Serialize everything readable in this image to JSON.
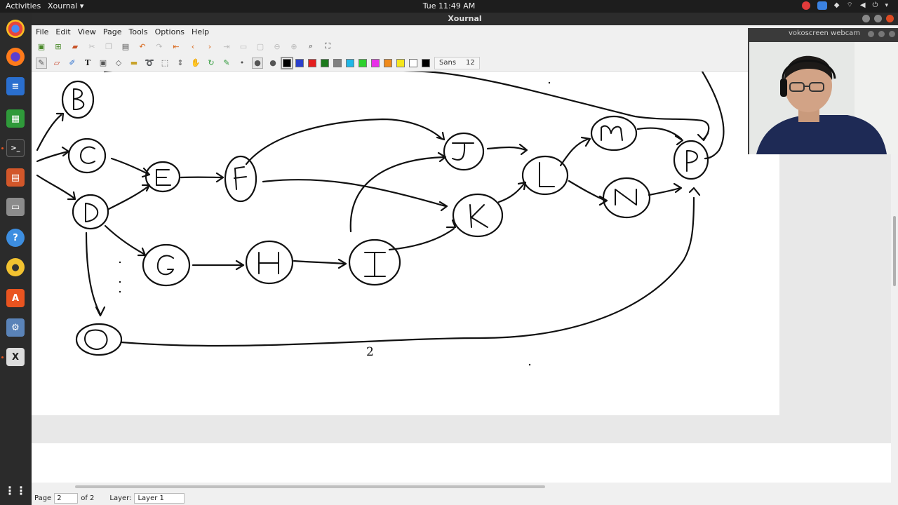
{
  "topbar": {
    "activities": "Activities",
    "app_menu": "Xournal ▾",
    "clock": "Tue 11:49 AM"
  },
  "window": {
    "title": "Xournal"
  },
  "menubar": {
    "items": [
      "File",
      "Edit",
      "View",
      "Page",
      "Tools",
      "Options",
      "Help"
    ]
  },
  "toolbar": {
    "font_name": "Sans",
    "font_size": "12",
    "colors": [
      "#000000",
      "#2a3fcc",
      "#e41f1f",
      "#1c7a1c",
      "#808080",
      "#1fb7e8",
      "#2ed12e",
      "#e830e8",
      "#f08a1a",
      "#f5e61c",
      "#ffffff",
      "#000000"
    ]
  },
  "canvas": {
    "page_number": "2",
    "nodes": [
      "B",
      "C",
      "D",
      "E",
      "F",
      "G",
      "H",
      "I",
      "J",
      "K",
      "L",
      "M",
      "N",
      "O",
      "P"
    ]
  },
  "statusbar": {
    "page_label": "Page",
    "page_value": "2",
    "page_of": "of 2",
    "layer_label": "Layer:",
    "layer_value": "Layer 1"
  },
  "webcam": {
    "title": "vokoscreen webcam"
  }
}
